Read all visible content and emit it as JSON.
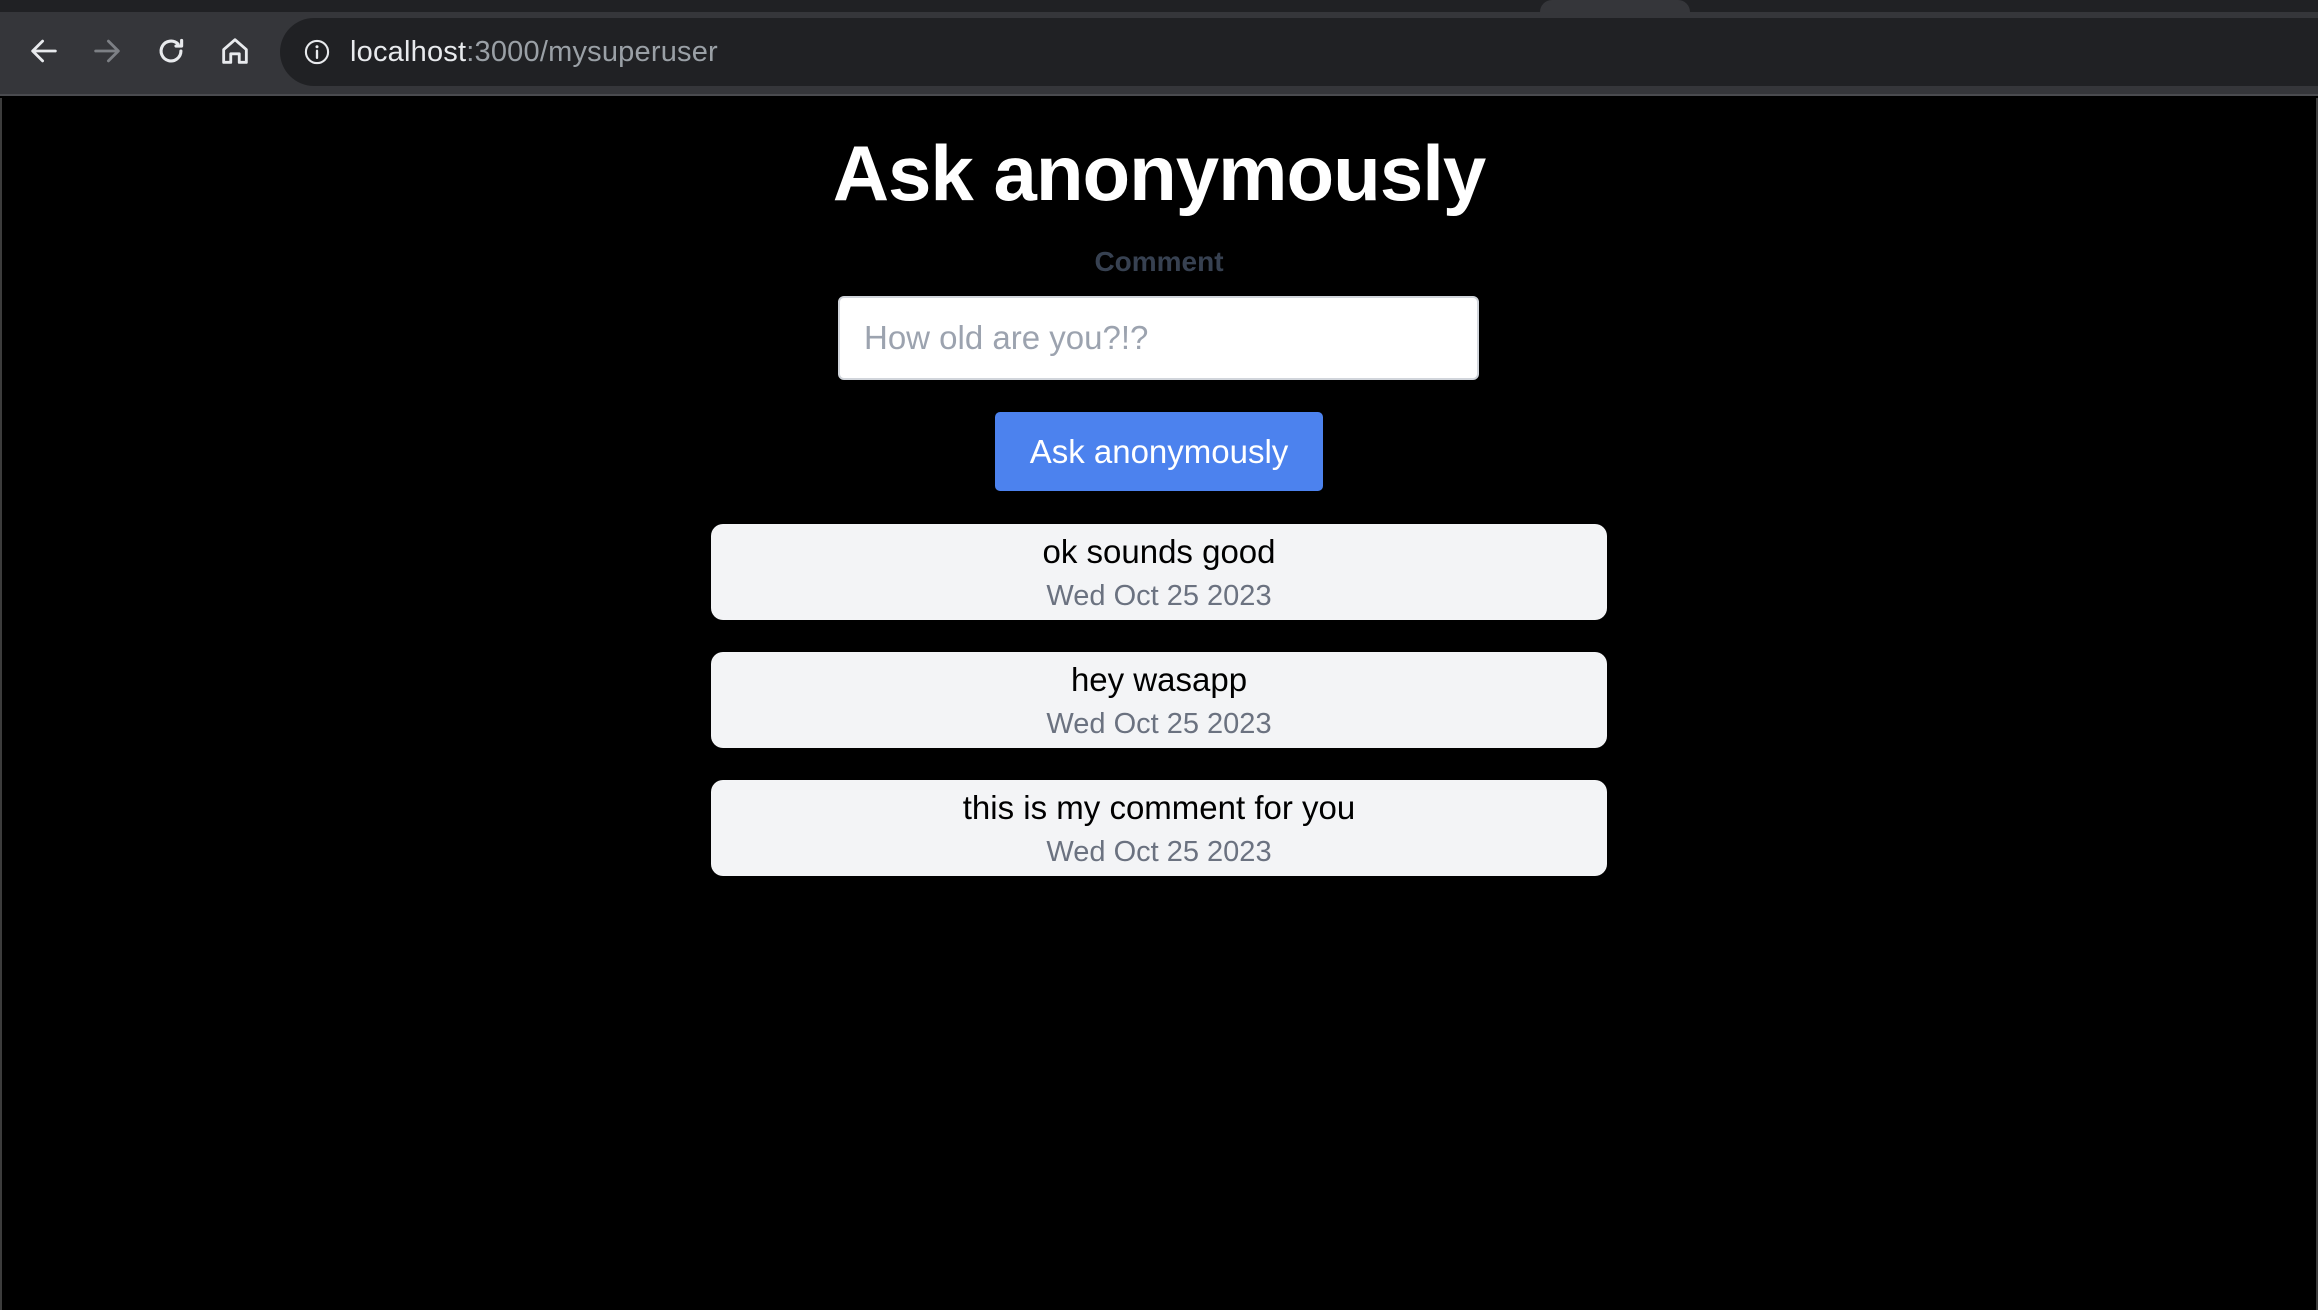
{
  "browser": {
    "url_host": "localhost",
    "url_path": ":3000/mysuperuser",
    "icons": {
      "back": "arrow-left-icon",
      "forward": "arrow-right-icon",
      "reload": "reload-icon",
      "home": "home-icon",
      "site_info": "info-icon"
    }
  },
  "page": {
    "title": "Ask anonymously",
    "form": {
      "label": "Comment",
      "input_value": "",
      "input_placeholder": "How old are you?!?",
      "submit_label": "Ask anonymously"
    },
    "comments": [
      {
        "text": "ok sounds good",
        "date": "Wed Oct 25 2023"
      },
      {
        "text": "hey wasapp",
        "date": "Wed Oct 25 2023"
      },
      {
        "text": "this is my comment for you",
        "date": "Wed Oct 25 2023"
      }
    ]
  },
  "colors": {
    "page_background": "#000000",
    "button_accent": "#4c82ee",
    "card_background": "#f3f4f6",
    "chrome_background": "#35363a",
    "omnibox_background": "#202124"
  }
}
